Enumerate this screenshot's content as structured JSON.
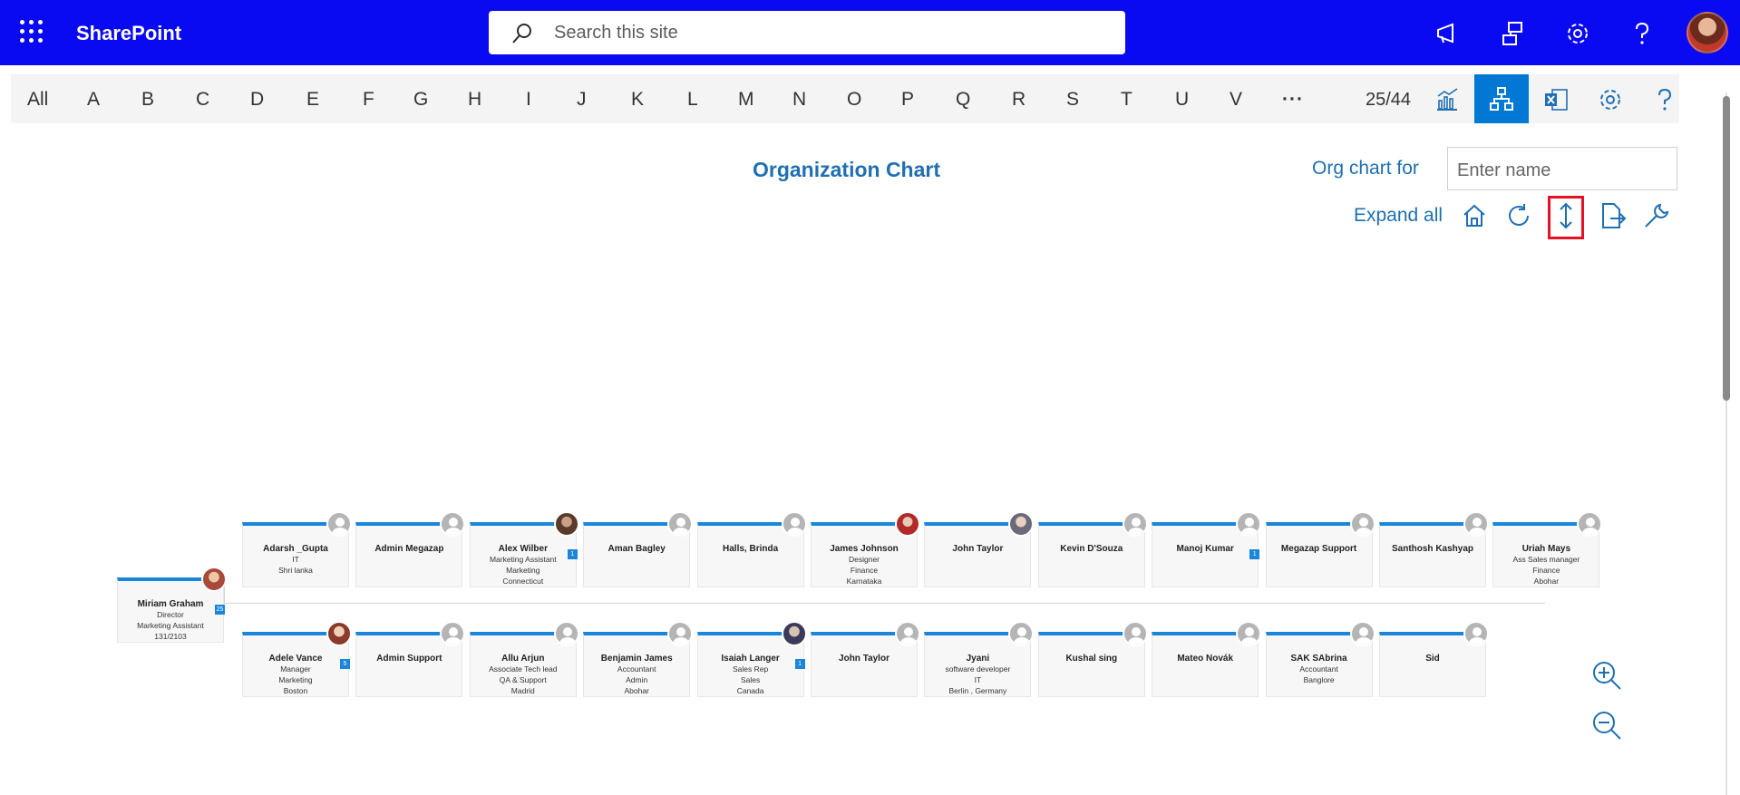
{
  "suite": {
    "brand": "SharePoint",
    "search_placeholder": "Search this site"
  },
  "alpha": {
    "letters": [
      "All",
      "A",
      "B",
      "C",
      "D",
      "E",
      "F",
      "G",
      "H",
      "I",
      "J",
      "K",
      "L",
      "M",
      "N",
      "O",
      "P",
      "Q",
      "R",
      "S",
      "T",
      "U",
      "V",
      "···"
    ],
    "count": "25/44"
  },
  "org": {
    "title": "Organization Chart",
    "for_label": "Org chart for",
    "name_placeholder": "Enter name",
    "expand_all": "Expand all"
  },
  "root": {
    "name": "Miriam Graham",
    "lines": [
      "Director",
      "Marketing Assistant",
      "131/2103"
    ],
    "badge": "25",
    "photo": "photo6"
  },
  "top_row": [
    {
      "name": "Adarsh _Gupta",
      "lines": [
        "IT",
        "Shri lanka"
      ],
      "photo": ""
    },
    {
      "name": "Admin Megazap",
      "lines": [],
      "photo": ""
    },
    {
      "name": "Alex Wilber",
      "lines": [
        "Marketing Assistant",
        "Marketing",
        "Connecticut"
      ],
      "photo": "photo1",
      "badge": "1"
    },
    {
      "name": "Aman Bagley",
      "lines": [],
      "photo": ""
    },
    {
      "name": "Halls, Brinda",
      "lines": [],
      "photo": ""
    },
    {
      "name": "James Johnson",
      "lines": [
        "Designer",
        "Finance",
        "Karnataka"
      ],
      "photo": "photo4"
    },
    {
      "name": "John Taylor",
      "lines": [],
      "photo": "photo5"
    },
    {
      "name": "Kevin D'Souza",
      "lines": [],
      "photo": ""
    },
    {
      "name": "Manoj Kumar",
      "lines": [],
      "photo": "",
      "badge": "1"
    },
    {
      "name": "Megazap Support",
      "lines": [],
      "photo": ""
    },
    {
      "name": "Santhosh Kashyap",
      "lines": [],
      "photo": ""
    },
    {
      "name": "Uriah Mays",
      "lines": [
        "Ass Sales manager",
        "Finance",
        "Abohar"
      ],
      "photo": ""
    }
  ],
  "bottom_row": [
    {
      "name": "Adele Vance",
      "lines": [
        "Manager",
        "Marketing",
        "Boston"
      ],
      "photo": "photo2",
      "badge": "5"
    },
    {
      "name": "Admin Support",
      "lines": [],
      "photo": ""
    },
    {
      "name": "Allu Arjun",
      "lines": [
        "Associate Tech lead",
        "QA & Support",
        "Madrid"
      ],
      "photo": ""
    },
    {
      "name": "Benjamin James",
      "lines": [
        "Accountant",
        "Admin",
        "Abohar"
      ],
      "photo": ""
    },
    {
      "name": "Isaiah Langer",
      "lines": [
        "Sales Rep",
        "Sales",
        "Canada"
      ],
      "photo": "photo3",
      "badge": "1"
    },
    {
      "name": "John Taylor",
      "lines": [],
      "photo": ""
    },
    {
      "name": "Jyani",
      "lines": [
        "software developer",
        "IT",
        "Berlin , Germany"
      ],
      "photo": ""
    },
    {
      "name": "Kushal sing",
      "lines": [],
      "photo": ""
    },
    {
      "name": "Mateo Novák",
      "lines": [],
      "photo": ""
    },
    {
      "name": "SAK SAbrina",
      "lines": [
        "Accountant",
        "Banglore"
      ],
      "photo": ""
    },
    {
      "name": "Sid",
      "lines": [],
      "photo": ""
    }
  ],
  "colors": {
    "suitebar": "#0a0af2",
    "accent": "#1a86d9",
    "title": "#1f6fb2",
    "highlight": "#e81123"
  }
}
